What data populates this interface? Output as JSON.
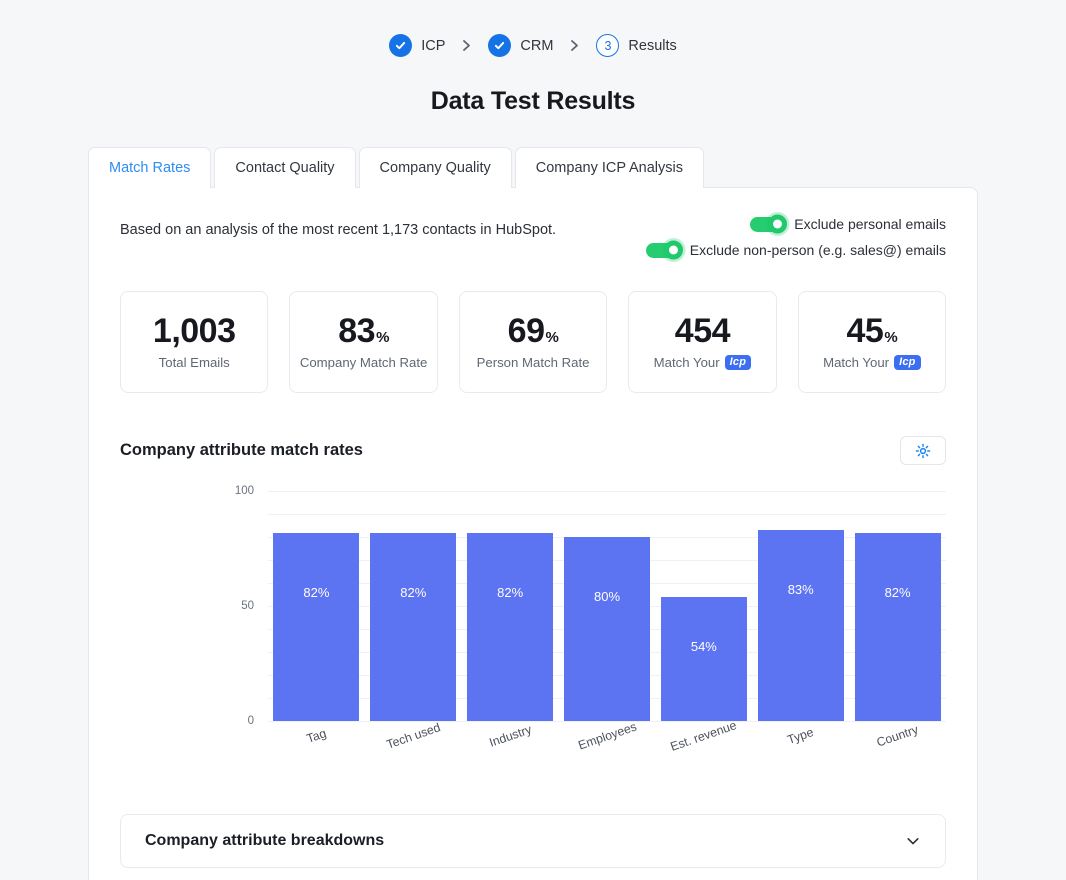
{
  "stepper": {
    "steps": [
      {
        "label": "ICP",
        "state": "done",
        "badge": "check-icon"
      },
      {
        "label": "CRM",
        "state": "done",
        "badge": "check-icon"
      },
      {
        "label": "Results",
        "state": "current",
        "badge": "3"
      }
    ]
  },
  "page": {
    "title": "Data Test Results"
  },
  "tabs": [
    {
      "label": "Match Rates",
      "active": true
    },
    {
      "label": "Contact Quality",
      "active": false
    },
    {
      "label": "Company Quality",
      "active": false
    },
    {
      "label": "Company ICP Analysis",
      "active": false
    }
  ],
  "summary": {
    "basis_text": "Based on an analysis of the most recent 1,173 contacts in HubSpot.",
    "toggles": [
      {
        "label": "Exclude personal emails",
        "on": true
      },
      {
        "label": "Exclude non-person (e.g. sales@) emails",
        "on": true
      }
    ]
  },
  "stats": [
    {
      "value": "1,003",
      "suffix": "",
      "label": "Total Emails",
      "badge": ""
    },
    {
      "value": "83",
      "suffix": "%",
      "label": "Company Match Rate",
      "badge": ""
    },
    {
      "value": "69",
      "suffix": "%",
      "label": "Person Match Rate",
      "badge": ""
    },
    {
      "value": "454",
      "suffix": "",
      "label": "Match Your",
      "badge": "Icp"
    },
    {
      "value": "45",
      "suffix": "%",
      "label": "Match Your",
      "badge": "Icp"
    }
  ],
  "chart_panel": {
    "title": "Company attribute match rates",
    "settings_icon": "gear-icon"
  },
  "chart_data": {
    "type": "bar",
    "title": "Company attribute match rates",
    "categories": [
      "Tag",
      "Tech used",
      "Industry",
      "Employees",
      "Est. revenue",
      "Type",
      "Country"
    ],
    "values": [
      82,
      82,
      82,
      80,
      54,
      83,
      82
    ],
    "value_labels": [
      "82%",
      "82%",
      "82%",
      "80%",
      "54%",
      "83%",
      "82%"
    ],
    "xlabel": "",
    "ylabel": "",
    "ylim": [
      0,
      100
    ],
    "ytick_labels": [
      "0",
      "50",
      "100"
    ],
    "yticks": [
      0,
      50,
      100
    ],
    "gridline_step": 10,
    "grid": true,
    "legend": "none",
    "bar_color": "#5c73f2",
    "label_rotation_deg": -19
  },
  "accordion": {
    "title": "Company attribute breakdowns",
    "icon": "chevron-down-icon",
    "expanded": false
  },
  "colors": {
    "accent_blue": "#2e8cf7",
    "step_blue": "#1673e6",
    "bar_blue": "#5c73f2",
    "toggle_green": "#1fc96c",
    "icp_badge_blue": "#3b6ef0",
    "page_bg": "#f6f7f9"
  }
}
